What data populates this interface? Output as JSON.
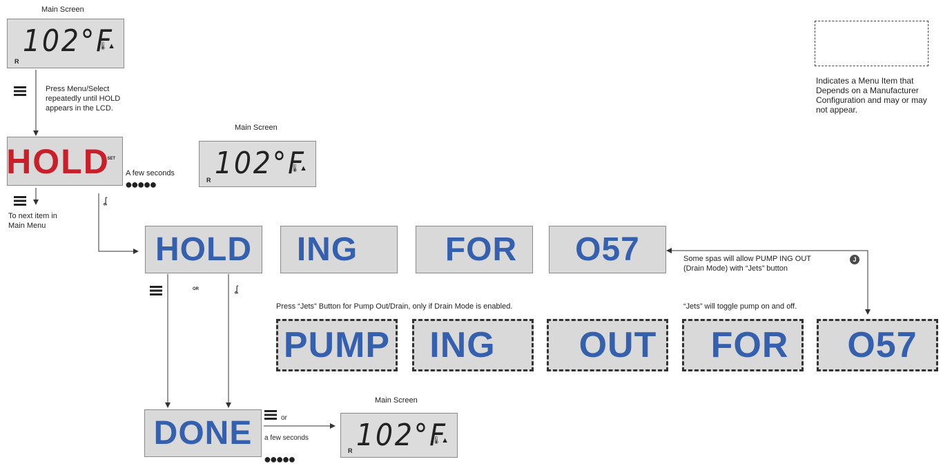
{
  "main_screen_label": "Main Screen",
  "lcd": {
    "temp": "102°F",
    "r_indicator": "R"
  },
  "hold_set": {
    "text": "HOLD",
    "set": "SET"
  },
  "press_menu_note": "Press Menu/Select repeatedly until HOLD appears in the LCD.",
  "to_next_item": "To next item in Main Menu",
  "a_few_seconds": "A few seconds",
  "a_few_seconds_lower": "a few seconds",
  "or_label": "OR",
  "or_label_lower": "or",
  "message_row": [
    "HOLD",
    "ING",
    "FOR",
    "O57"
  ],
  "pump_row": [
    "PUMP",
    "ING",
    "OUT",
    "FOR",
    "O57"
  ],
  "done": "DONE",
  "pump_note": "Press “Jets” Button for Pump Out/Drain, only if Drain Mode is enabled.",
  "some_spas_note": "Some spas will allow PUMP ING OUT (Drain Mode) with “Jets” button",
  "toggle_note": "“Jets” will toggle pump on and off.",
  "legend_note": "Indicates a Menu Item that Depends on a Manufacturer Configuration and may or may not appear.",
  "colors": {
    "hold_red": "#c8202a",
    "box_blue": "#3560ad",
    "lcd_gray": "#d9d9d9"
  },
  "icons": [
    "menu-icon",
    "temp-button-icon",
    "jets-button-icon"
  ]
}
